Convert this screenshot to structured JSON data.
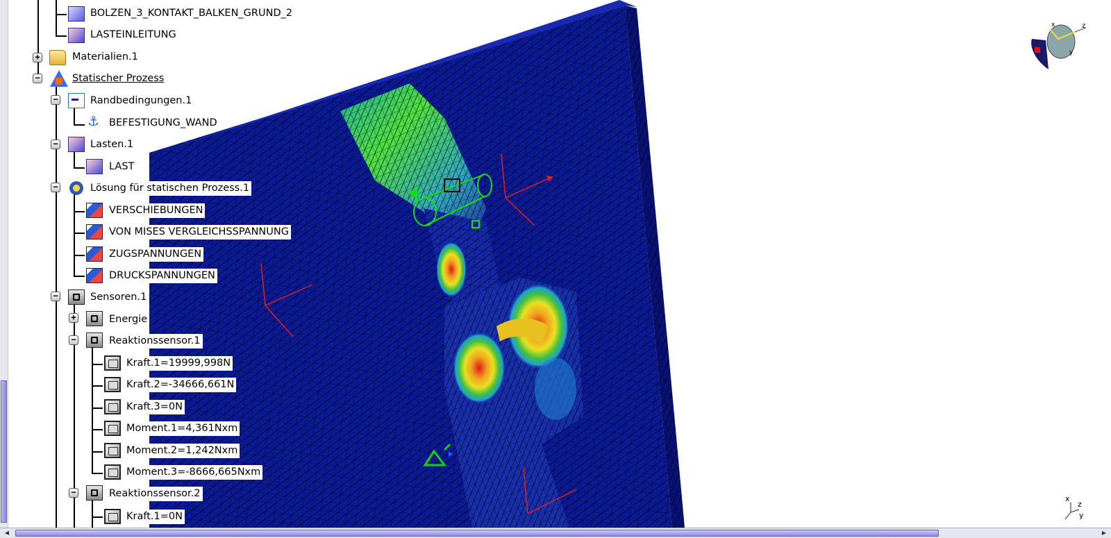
{
  "tree": {
    "items": [
      {
        "label": "BOLZEN_3_KONTAKT_BALKEN_GRUND_2",
        "icon": "part-constraint-icon"
      },
      {
        "label": "LASTEINLEITUNG",
        "icon": "load-introduction-icon"
      },
      {
        "label": "Materialien.1",
        "icon": "folder-icon",
        "expander": "+"
      },
      {
        "label": "Statischer Prozess",
        "icon": "static-process-icon",
        "expander": "−"
      },
      {
        "label": "Randbedingungen.1",
        "icon": "boundary-conditions-icon",
        "expander": "−"
      },
      {
        "label": "BEFESTIGUNG_WAND",
        "icon": "clamp-fixation-icon"
      },
      {
        "label": "Lasten.1",
        "icon": "loads-icon",
        "expander": "−"
      },
      {
        "label": "LAST",
        "icon": "load-icon"
      },
      {
        "label": "Lösung für statischen Prozess.1",
        "icon": "solution-gear-icon",
        "expander": "−"
      },
      {
        "label": "VERSCHIEBUNGEN",
        "icon": "result-image-icon"
      },
      {
        "label": "VON MISES VERGLEICHSSPANNUNG",
        "icon": "result-image-icon"
      },
      {
        "label": "ZUGSPANNUNGEN",
        "icon": "result-image-icon"
      },
      {
        "label": "DRUCKSPANNUNGEN",
        "icon": "result-image-icon"
      },
      {
        "label": "Sensoren.1",
        "icon": "sensors-icon",
        "expander": "−"
      },
      {
        "label": "Energie",
        "icon": "sensor-icon",
        "expander": "+"
      },
      {
        "label": "Reaktionssensor.1",
        "icon": "reaction-sensor-icon",
        "expander": "−"
      },
      {
        "label": "Kraft.1=19999,998N",
        "icon": "force-value-icon"
      },
      {
        "label": "Kraft.2=-34666,661N",
        "icon": "force-value-icon"
      },
      {
        "label": "Kraft.3=0N",
        "icon": "force-value-icon"
      },
      {
        "label": "Moment.1=4,361Nxm",
        "icon": "moment-value-icon"
      },
      {
        "label": "Moment.2=1,242Nxm",
        "icon": "moment-value-icon"
      },
      {
        "label": "Moment.3=-8666,665Nxm",
        "icon": "moment-value-icon"
      },
      {
        "label": "Reaktionssensor.2",
        "icon": "reaction-sensor-icon",
        "expander": "−"
      },
      {
        "label": "Kraft.1=0N",
        "icon": "force-value-icon"
      }
    ]
  },
  "viewport": {
    "compass_axes": [
      "z",
      "x",
      "y"
    ],
    "mini_axes": [
      "x",
      "z",
      "y"
    ]
  },
  "colors": {
    "mesh_blue": "#0a1a8c",
    "stress_green": "#40d040",
    "stress_red": "#e02020",
    "axis_red": "#e02020",
    "selection": "#00e000"
  }
}
